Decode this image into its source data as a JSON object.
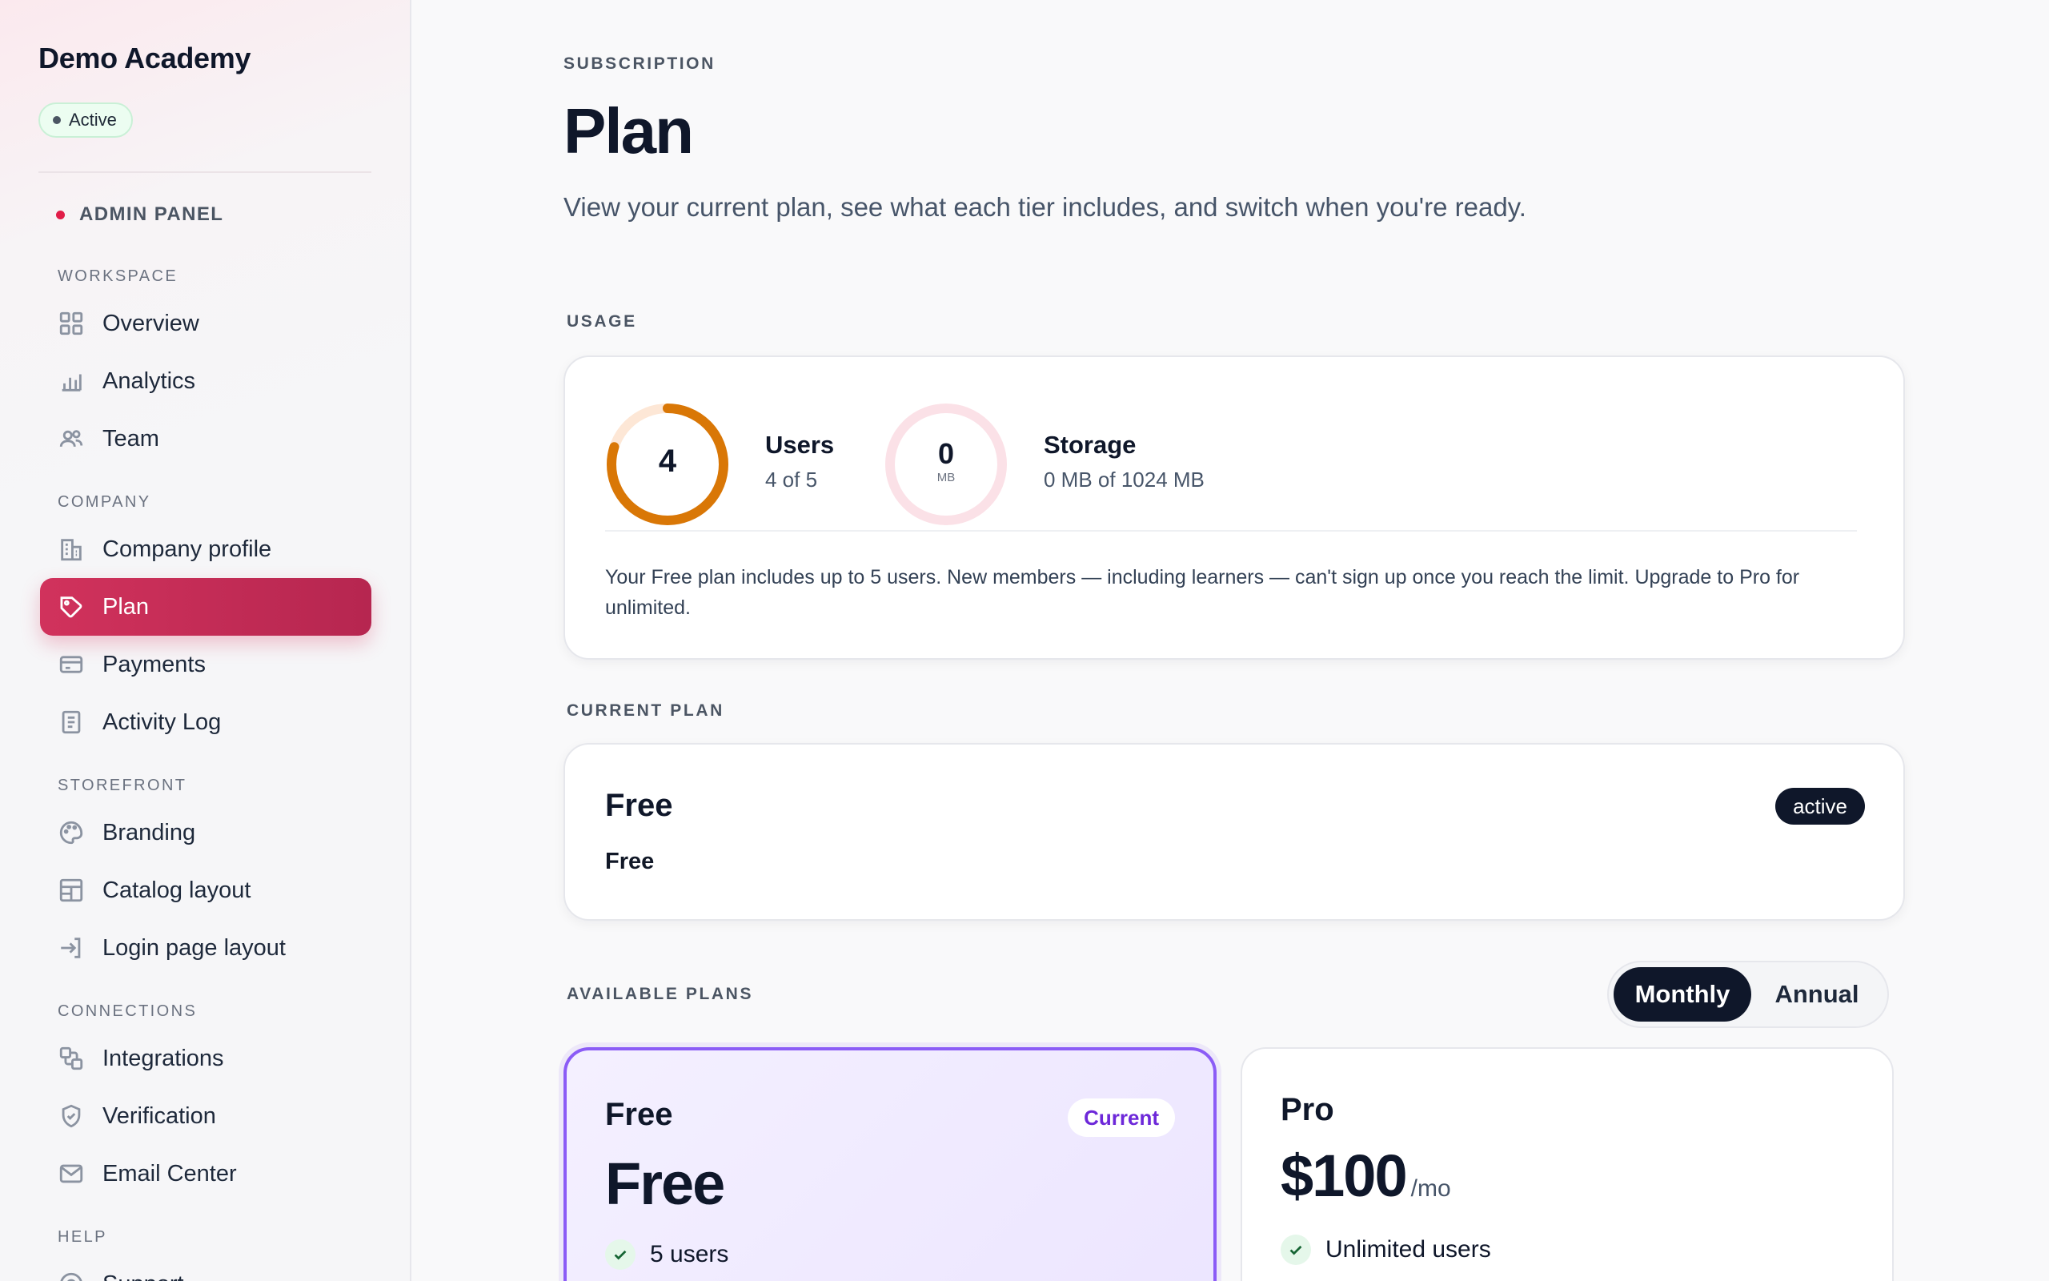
{
  "sidebar": {
    "brand": "Demo Academy",
    "status": "Active",
    "panel_label": "ADMIN PANEL",
    "groups": [
      {
        "title": "WORKSPACE",
        "items": [
          {
            "label": "Overview",
            "icon": "grid-icon"
          },
          {
            "label": "Analytics",
            "icon": "bar-chart-icon"
          },
          {
            "label": "Team",
            "icon": "users-icon"
          }
        ]
      },
      {
        "title": "COMPANY",
        "items": [
          {
            "label": "Company profile",
            "icon": "building-icon"
          },
          {
            "label": "Plan",
            "icon": "tag-icon",
            "selected": true
          },
          {
            "label": "Payments",
            "icon": "credit-card-icon"
          },
          {
            "label": "Activity Log",
            "icon": "document-icon"
          }
        ]
      },
      {
        "title": "STOREFRONT",
        "items": [
          {
            "label": "Branding",
            "icon": "palette-icon"
          },
          {
            "label": "Catalog layout",
            "icon": "layout-icon"
          },
          {
            "label": "Login page layout",
            "icon": "login-icon"
          }
        ]
      },
      {
        "title": "CONNECTIONS",
        "items": [
          {
            "label": "Integrations",
            "icon": "integrations-icon"
          },
          {
            "label": "Verification",
            "icon": "shield-check-icon"
          },
          {
            "label": "Email Center",
            "icon": "mail-icon"
          }
        ]
      },
      {
        "title": "HELP",
        "items": [
          {
            "label": "Support",
            "icon": "help-circle-icon"
          }
        ]
      }
    ]
  },
  "header": {
    "eyebrow": "SUBSCRIPTION",
    "title": "Plan",
    "description": "View your current plan, see what each tier includes, and switch when you're ready."
  },
  "usage": {
    "section_label": "USAGE",
    "users": {
      "value": "4",
      "title": "Users",
      "detail": "4 of 5",
      "fraction": 0.8,
      "color": "#d97706",
      "track": "#fde7d6"
    },
    "storage": {
      "value": "0",
      "unit": "MB",
      "title": "Storage",
      "detail": "0 MB of 1024 MB",
      "fraction": 0,
      "color": "#e11d48",
      "track": "#fbe1e7"
    },
    "note": "Your Free plan includes up to 5 users. New members — including learners — can't sign up once you reach the limit. Upgrade to Pro for unlimited."
  },
  "current_plan": {
    "section_label": "CURRENT PLAN",
    "name": "Free",
    "price": "Free",
    "status": "active"
  },
  "available_plans": {
    "section_label": "AVAILABLE PLANS",
    "billing": {
      "monthly": "Monthly",
      "annual": "Annual",
      "selected": "Monthly"
    },
    "plans": [
      {
        "name": "Free",
        "price": "Free",
        "per": "",
        "badge": "Current",
        "feature": "5 users"
      },
      {
        "name": "Pro",
        "price": "$100",
        "per": "/mo",
        "badge": "",
        "feature": "Unlimited users"
      }
    ]
  },
  "colors": {
    "accent": "#c82c56",
    "selected_plan_border": "#8b5cf6",
    "dark": "#0f172a"
  }
}
